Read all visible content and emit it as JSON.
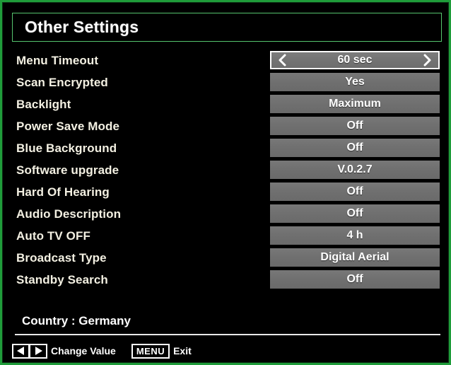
{
  "screen": {
    "title": "Other Settings",
    "frame_color": "#1f9c3a",
    "bar_color": "#707070",
    "highlight_border_color": "#ffffff"
  },
  "settings": [
    {
      "label": "Menu Timeout",
      "value": "60 sec",
      "selected": true
    },
    {
      "label": "Scan Encrypted",
      "value": "Yes",
      "selected": false
    },
    {
      "label": "Backlight",
      "value": "Maximum",
      "selected": false
    },
    {
      "label": "Power Save Mode",
      "value": "Off",
      "selected": false
    },
    {
      "label": "Blue Background",
      "value": "Off",
      "selected": false
    },
    {
      "label": "Software upgrade",
      "value": "V.0.2.7",
      "selected": false
    },
    {
      "label": "Hard Of Hearing",
      "value": "Off",
      "selected": false
    },
    {
      "label": "Audio Description",
      "value": "Off",
      "selected": false
    },
    {
      "label": "Auto TV OFF",
      "value": "4 h",
      "selected": false
    },
    {
      "label": "Broadcast Type",
      "value": "Digital Aerial",
      "selected": false
    },
    {
      "label": "Standby Search",
      "value": "Off",
      "selected": false
    }
  ],
  "status": {
    "country_line": "Country : Germany"
  },
  "footer": {
    "change_value_hint": "Change Value",
    "menu_key_label": "MENU",
    "exit_hint": "Exit"
  }
}
